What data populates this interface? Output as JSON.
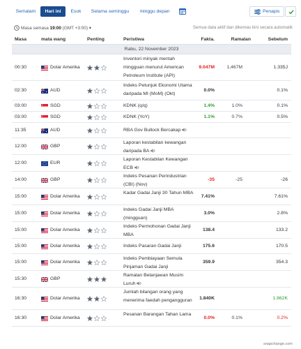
{
  "tabs": {
    "yesterday": "Semalam",
    "today": "Hari ini",
    "tomorrow": "Esok",
    "this_week": "Selama seminggu",
    "next_week": "minggu depan",
    "filter": "Penapis"
  },
  "timebar": {
    "prefix": "Masa semasa",
    "time": "19:00",
    "tz": "(GMT +3:00)",
    "note": "Semua data aktif dan dikemas kini secara automatik"
  },
  "headers": {
    "time": "Masa",
    "currency": "mata wang",
    "importance": "Penting",
    "event": "Peristiwa",
    "actual": "Fakta.",
    "forecast": "Ramalan",
    "previous": "Sebelum"
  },
  "date": "Rabu, 22 November 2023",
  "rows": [
    {
      "time": "00:30",
      "flag": "us",
      "currency": "Dolar Amerika",
      "stars": 2,
      "event": "Inventori minyak mentah mingguan menurut American Petroleum Institute (API)",
      "actual": "9.047M",
      "actual_color": "red",
      "forecast": "1,467M",
      "previous": "1.335J",
      "prev_color": "",
      "speaker": false
    },
    {
      "time": "02:30",
      "flag": "au",
      "currency": "AUD",
      "stars": 1,
      "event": "Indeks Petunjuk Ekonomi Utama daripada MI (MoM) (Okt)",
      "actual": "0.0%",
      "actual_color": "",
      "forecast": "",
      "previous": "0.1%",
      "prev_color": "",
      "speaker": false
    },
    {
      "time": "03:00",
      "flag": "sg",
      "currency": "SGD",
      "stars": 1,
      "event": "KDNK (q/q)",
      "actual": "1.4%",
      "actual_color": "green",
      "forecast": "1.0%",
      "previous": "0.1%",
      "prev_color": "",
      "speaker": false
    },
    {
      "time": "03:00",
      "flag": "sg",
      "currency": "SGD",
      "stars": 1,
      "event": "KDNK (YoY)",
      "actual": "1.1%",
      "actual_color": "green",
      "forecast": "0.7%",
      "previous": "0.5%",
      "prev_color": "",
      "speaker": false
    },
    {
      "time": "11:35",
      "flag": "au",
      "currency": "AUD",
      "stars": 1,
      "event": "RBA Gov Bullock Bercakap",
      "actual": "",
      "actual_color": "",
      "forecast": "",
      "previous": "",
      "prev_color": "",
      "speaker": true
    },
    {
      "time": "12:00",
      "flag": "gb",
      "currency": "GBP",
      "stars": 1,
      "event": "Laporan kestabilan kewangan daripada BA",
      "actual": "",
      "actual_color": "",
      "forecast": "",
      "previous": "",
      "prev_color": "",
      "speaker": true
    },
    {
      "time": "12:00",
      "flag": "eu",
      "currency": "EUR",
      "stars": 1,
      "event": "Laporan Kestabilan Kewangan ECB",
      "actual": "",
      "actual_color": "",
      "forecast": "",
      "previous": "",
      "prev_color": "",
      "speaker": true
    },
    {
      "time": "14:00",
      "flag": "gb",
      "currency": "GBP",
      "stars": 1,
      "event": "Indeks Pesanan Perindustrian (CBI) (Nov)",
      "actual": "-35",
      "actual_color": "red",
      "forecast": "-25",
      "previous": "-26",
      "prev_color": "",
      "speaker": false
    },
    {
      "time": "15:00",
      "flag": "us",
      "currency": "Dolar Amerika",
      "stars": 1,
      "event": "Kadar Gadai Janji 30 Tahun MBA",
      "actual": "7.41%",
      "actual_color": "",
      "forecast": "",
      "previous": "7.61%",
      "prev_color": "",
      "speaker": false
    },
    {
      "time": "15:00",
      "flag": "us",
      "currency": "Dolar Amerika",
      "stars": 1,
      "event": "Indeks Gadai Janji MBA (mingguan)",
      "actual": "3.0%",
      "actual_color": "",
      "forecast": "",
      "previous": "2.8%",
      "prev_color": "",
      "speaker": false
    },
    {
      "time": "15:00",
      "flag": "us",
      "currency": "Dolar Amerika",
      "stars": 1,
      "event": "Indeks Permohonan Gadai Janji MBA",
      "actual": "138.4",
      "actual_color": "",
      "forecast": "",
      "previous": "133.2",
      "prev_color": "",
      "speaker": false
    },
    {
      "time": "15:00",
      "flag": "us",
      "currency": "Dolar Amerika",
      "stars": 1,
      "event": "Indeks Pasaran Gadai Janji",
      "actual": "175.6",
      "actual_color": "",
      "forecast": "",
      "previous": "170.5",
      "prev_color": "",
      "speaker": false
    },
    {
      "time": "15:00",
      "flag": "us",
      "currency": "Dolar Amerika",
      "stars": 1,
      "event": "Indeks Pembiayaan Semula Pinjaman Gadai Janji",
      "actual": "359.9",
      "actual_color": "",
      "forecast": "",
      "previous": "354.3",
      "prev_color": "",
      "speaker": false
    },
    {
      "time": "15:30",
      "flag": "gb",
      "currency": "GBP",
      "stars": 3,
      "event": "Ramalan Belanjawan Musim Luruh",
      "actual": "",
      "actual_color": "",
      "forecast": "",
      "previous": "",
      "prev_color": "",
      "speaker": true
    },
    {
      "time": "16:30",
      "flag": "us",
      "currency": "Dolar Amerika",
      "stars": 2,
      "event": "Jumlah bilangan orang yang menerima faedah pengangguran",
      "actual": "1.840K",
      "actual_color": "",
      "forecast": "",
      "previous": "1.862K",
      "prev_color": "green",
      "speaker": false
    },
    {
      "time": "16:30",
      "flag": "us",
      "currency": "Dolar Amerika",
      "stars": 1,
      "event": "Pesanan Barangan Tahan Lama",
      "actual": "0.0%",
      "actual_color": "red",
      "forecast": "0.1%",
      "previous": "0.2%",
      "prev_color": "red",
      "speaker": false
    }
  ],
  "watermark": "snapchange.com"
}
